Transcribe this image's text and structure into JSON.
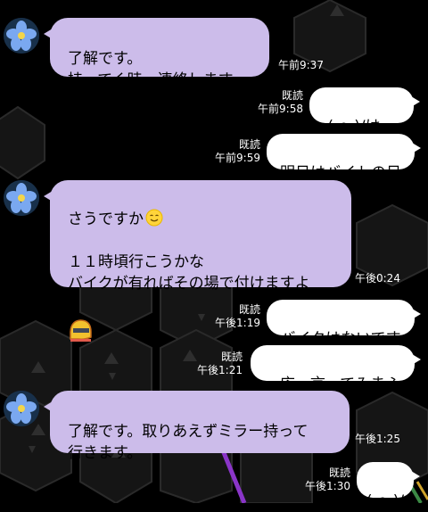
{
  "messages": [
    {
      "text": "了解です。\n持ってく時、連絡します。",
      "time": "午前9:37"
    },
    {
      "text": "(-o-)/は〜い",
      "read": "既読",
      "time": "午前9:58"
    },
    {
      "text": "明日はバイトの日",
      "read": "既読",
      "time": "午前9:59"
    },
    {
      "text": "さうですか",
      "text2": "１１時頃行こうかな\nバイクが有ればその場で付けますよ",
      "time": "午後0:24"
    },
    {
      "text": "バイクはないです",
      "read": "既読",
      "time": "午後1:19"
    },
    {
      "text": "一応　言ってみまふ",
      "read": "既読",
      "time": "午後1:21"
    },
    {
      "text": "了解です。取りあえずミラー持って\n行きます。",
      "time": "午後1:25"
    },
    {
      "text": "(-o-)/",
      "read": "既読",
      "time": "午後1:30"
    }
  ],
  "icons": {
    "avatar": "blue-flower-avatar",
    "smile": "smiling-face-emoji",
    "helmet": "helmet-emoji"
  },
  "colors": {
    "background": "#000000",
    "incoming_bubble": "#ccbcea",
    "outgoing_bubble": "#ffffff"
  }
}
